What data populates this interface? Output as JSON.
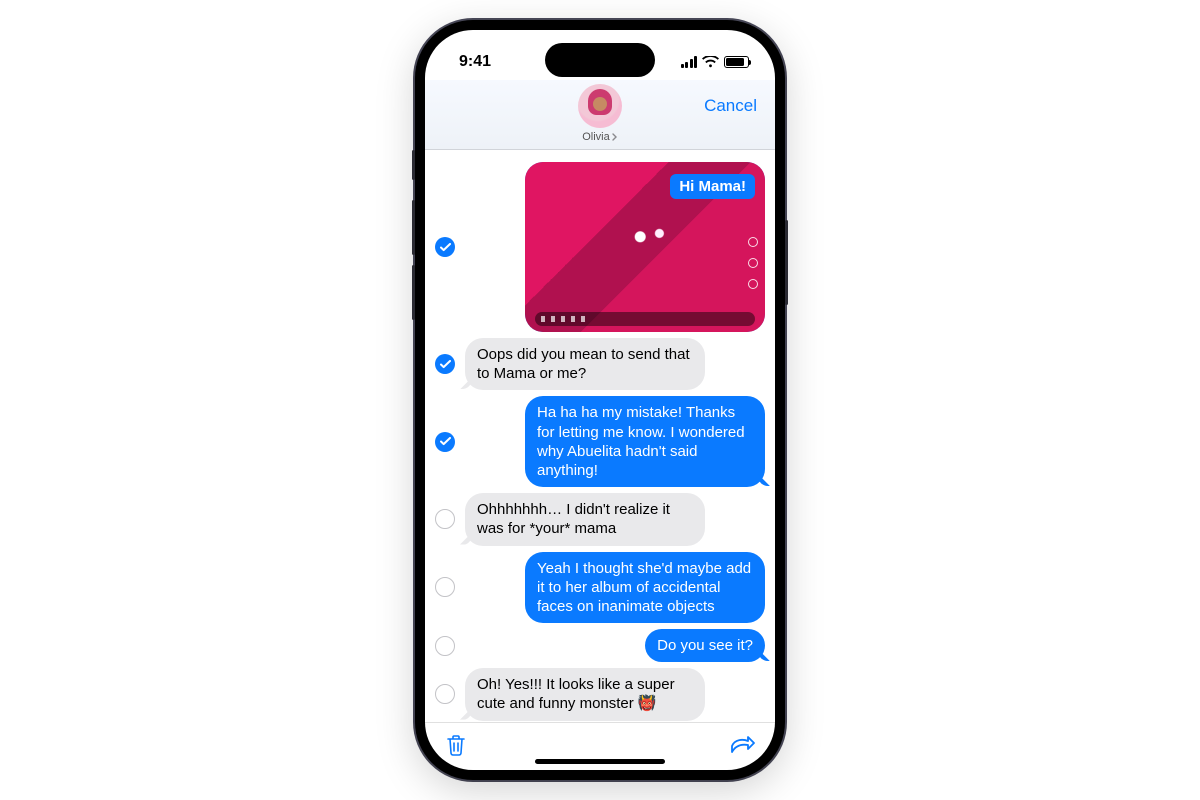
{
  "status": {
    "time": "9:41"
  },
  "nav": {
    "contact_name": "Olivia",
    "cancel_label": "Cancel"
  },
  "photo": {
    "caption": "Hi Mama!"
  },
  "messages": [
    {
      "id": 0,
      "side": "sent",
      "type": "photo",
      "selected": true
    },
    {
      "id": 1,
      "side": "received",
      "selected": true,
      "text": "Oops did you mean to send that to Mama or me?"
    },
    {
      "id": 2,
      "side": "sent",
      "selected": true,
      "text": "Ha ha ha my mistake! Thanks for letting me know. I wondered why Abuelita hadn't said anything!"
    },
    {
      "id": 3,
      "side": "received",
      "selected": false,
      "text": "Ohhhhhhh… I didn't realize it was for *your* mama"
    },
    {
      "id": 4,
      "side": "sent",
      "selected": false,
      "text": "Yeah I thought she'd maybe add it to her album of accidental faces on inanimate objects"
    },
    {
      "id": 5,
      "side": "sent",
      "selected": false,
      "text": "Do you see it?"
    },
    {
      "id": 6,
      "side": "received",
      "selected": false,
      "text": "Oh! Yes!!! It looks like a super cute and funny monster 👹"
    }
  ],
  "toolbar": {
    "delete": "Delete",
    "share": "Share"
  }
}
